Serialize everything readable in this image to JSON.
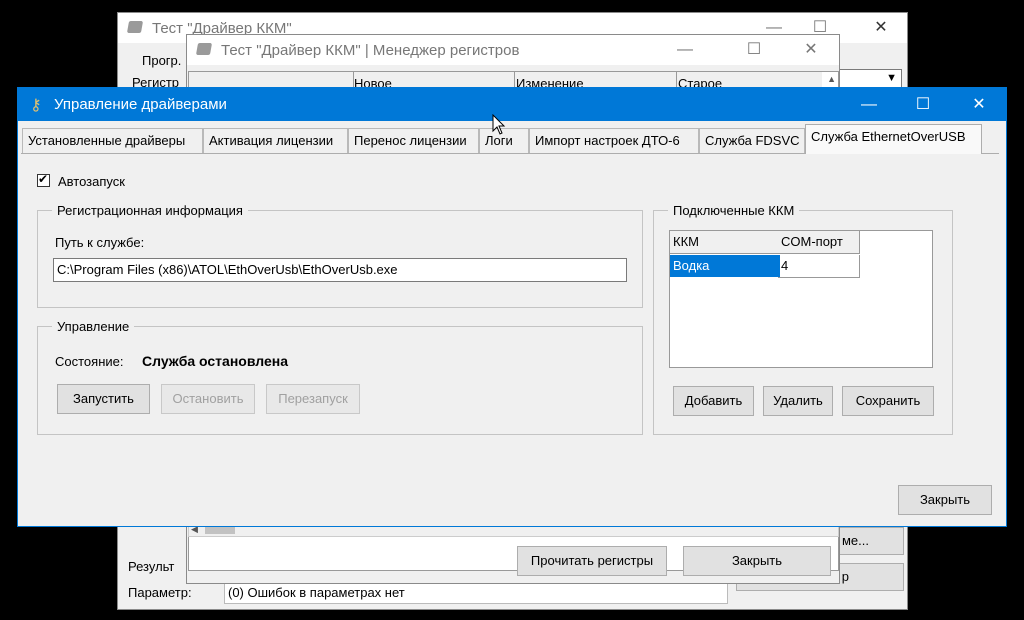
{
  "back_window": {
    "title": "Тест \"Драйвер ККМ\"",
    "tab_partial": "Прогр.",
    "reg_label_partial": "Регистр",
    "results_label_partial": "Результ",
    "param_label": "Параметр:",
    "param_value": "(0) Ошибок в параметрах нет",
    "button_partial_a": "ме...",
    "button_partial_b": "р"
  },
  "registers_window": {
    "title": "Тест \"Драйвер ККМ\" | Менеджер регистров",
    "columns": [
      "",
      "Новое",
      "Изменение",
      "Старое"
    ],
    "read_button": "Прочитать регистры",
    "close_button": "Закрыть"
  },
  "main_window": {
    "title": "Управление драйверами",
    "tabs": [
      {
        "label": "Установленные драйверы"
      },
      {
        "label": "Активация лицензии"
      },
      {
        "label": "Перенос лицензии"
      },
      {
        "label": "Логи"
      },
      {
        "label": "Импорт настроек ДТО-6"
      },
      {
        "label": "Служба FDSVC"
      },
      {
        "label": "Служба EthernetOverUSB",
        "active": true
      }
    ],
    "autostart_label": "Автозапуск",
    "autostart_checked": true,
    "reg_group": {
      "title": "Регистрационная информация",
      "path_label": "Путь к службе:",
      "path_value": "C:\\Program Files (x86)\\ATOL\\EthOverUsb\\EthOverUsb.exe"
    },
    "control_group": {
      "title": "Управление",
      "state_label": "Состояние:",
      "state_value": "Служба остановлена",
      "start_button": "Запустить",
      "stop_button": "Остановить",
      "restart_button": "Перезапуск"
    },
    "kkm_group": {
      "title": "Подключенные ККМ",
      "columns": [
        "ККМ",
        "COM-порт"
      ],
      "rows": [
        {
          "kkm": "Водка",
          "port": "4"
        }
      ],
      "add_button": "Добавить",
      "delete_button": "Удалить",
      "save_button": "Сохранить"
    },
    "close_button": "Закрыть"
  },
  "colors": {
    "titlebar_active": "#0078d7",
    "selection": "#0078d7",
    "window_bg": "#f0f0f0"
  }
}
